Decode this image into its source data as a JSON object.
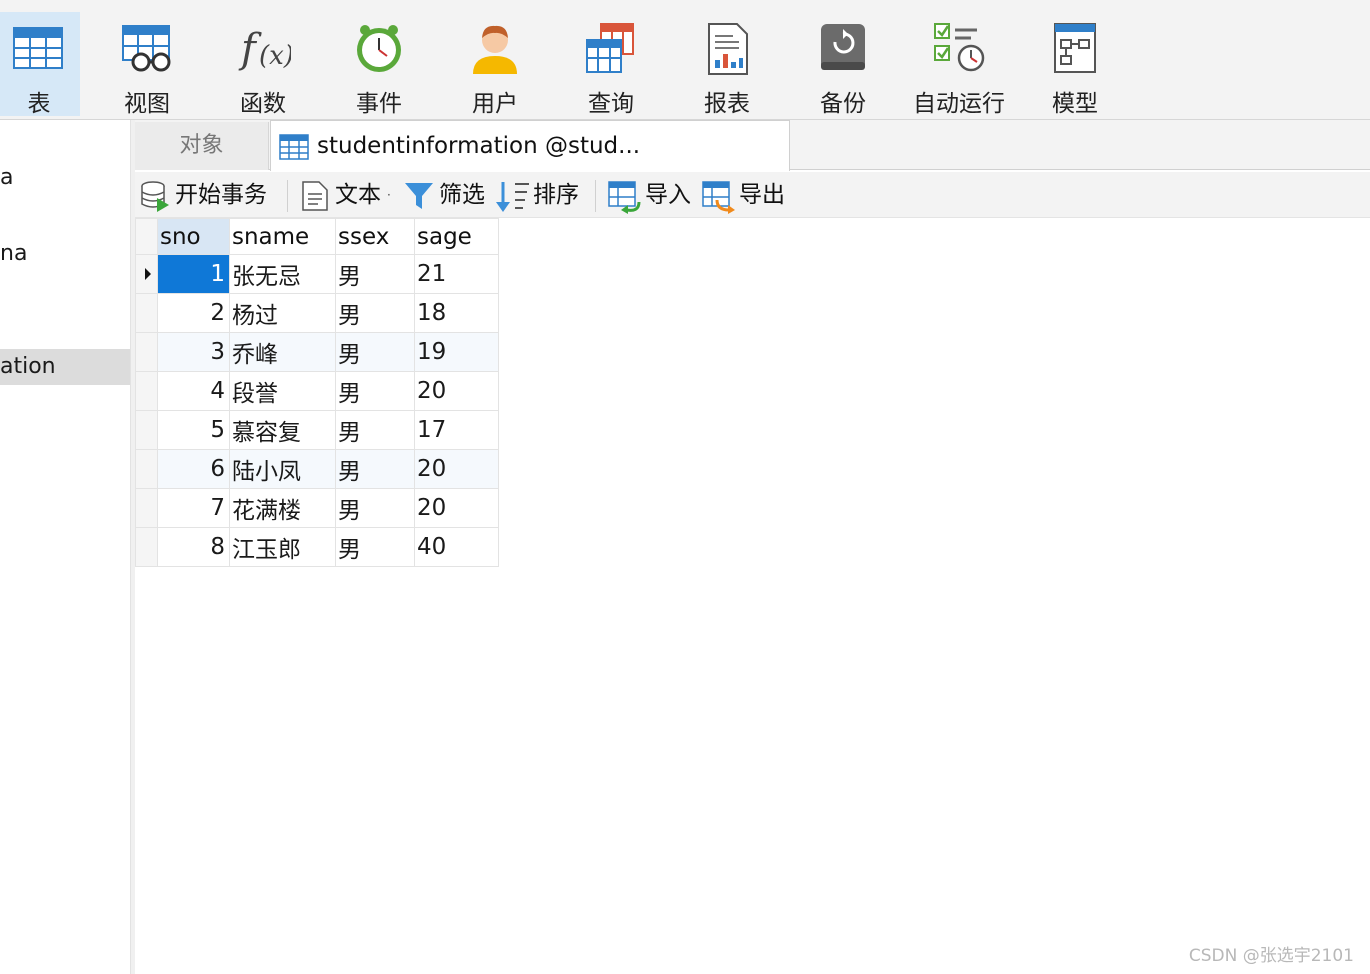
{
  "ribbon": {
    "buttons": [
      {
        "label": "表",
        "icon": "table-icon",
        "active": true
      },
      {
        "label": "视图",
        "icon": "view-icon"
      },
      {
        "label": "函数",
        "icon": "function-icon"
      },
      {
        "label": "事件",
        "icon": "event-clock-icon"
      },
      {
        "label": "用户",
        "icon": "user-icon"
      },
      {
        "label": "查询",
        "icon": "query-icon"
      },
      {
        "label": "报表",
        "icon": "report-icon"
      },
      {
        "label": "备份",
        "icon": "backup-icon"
      },
      {
        "label": "自动运行",
        "icon": "automation-icon"
      },
      {
        "label": "模型",
        "icon": "model-icon"
      }
    ]
  },
  "sidebar": {
    "items": [
      {
        "label": "a"
      },
      {
        "label": "na"
      },
      {
        "label": "ation",
        "selected": true
      }
    ]
  },
  "tabs": {
    "objects": "对象",
    "table_tab": "studentinformation @stud..."
  },
  "toolbar": {
    "begin_transaction": "开始事务",
    "text": "文本",
    "filter": "筛选",
    "sort": "排序",
    "import": "导入",
    "export": "导出"
  },
  "grid": {
    "columns": [
      "sno",
      "sname",
      "ssex",
      "sage"
    ],
    "rows": [
      [
        "1",
        "张无忌",
        "男",
        "21"
      ],
      [
        "2",
        "杨过",
        "男",
        "18"
      ],
      [
        "3",
        "乔峰",
        "男",
        "19"
      ],
      [
        "4",
        "段誉",
        "男",
        "20"
      ],
      [
        "5",
        "慕容复",
        "男",
        "17"
      ],
      [
        "6",
        "陆小凤",
        "男",
        "20"
      ],
      [
        "7",
        "花满楼",
        "男",
        "20"
      ],
      [
        "8",
        "江玉郎",
        "男",
        "40"
      ]
    ]
  },
  "watermark": "CSDN @张选宇2101",
  "colors": {
    "accent": "#0f78d7",
    "ribbon_active": "#d6e8f7",
    "sidebar_selected": "#dcdcdc"
  }
}
